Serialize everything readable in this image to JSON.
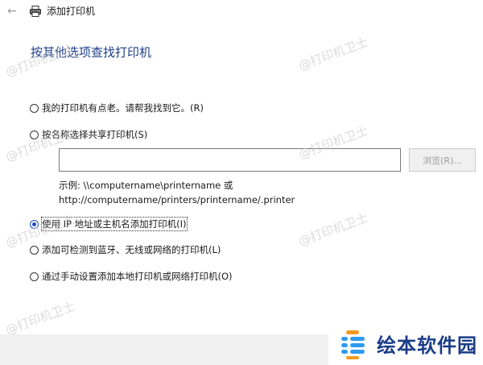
{
  "window": {
    "title": "添加打印机",
    "back_glyph": "←",
    "icon": "printer-icon"
  },
  "heading": "按其他选项查找打印机",
  "options": [
    {
      "label": "我的打印机有点老。请帮我找到它。(R)",
      "checked": false
    },
    {
      "label": "按名称选择共享打印机(S)",
      "checked": false
    },
    {
      "label": "使用 IP 地址或主机名添加打印机(I)",
      "checked": true
    },
    {
      "label": "添加可检测到蓝牙、无线或网络的打印机(L)",
      "checked": false
    },
    {
      "label": "通过手动设置添加本地打印机或网络打印机(O)",
      "checked": false
    }
  ],
  "share": {
    "input_value": "",
    "browse_label": "浏览(R)...",
    "example_line1": "示例: \\\\computername\\printername 或",
    "example_line2": "http://computername/printers/printername/.printer"
  },
  "watermark_text": "@打印机卫士",
  "logo": {
    "text": "绘本软件园"
  },
  "colors": {
    "heading": "#1e3f8a",
    "radio_accent": "#1e4fc7",
    "logo_text": "#1a3c86"
  }
}
